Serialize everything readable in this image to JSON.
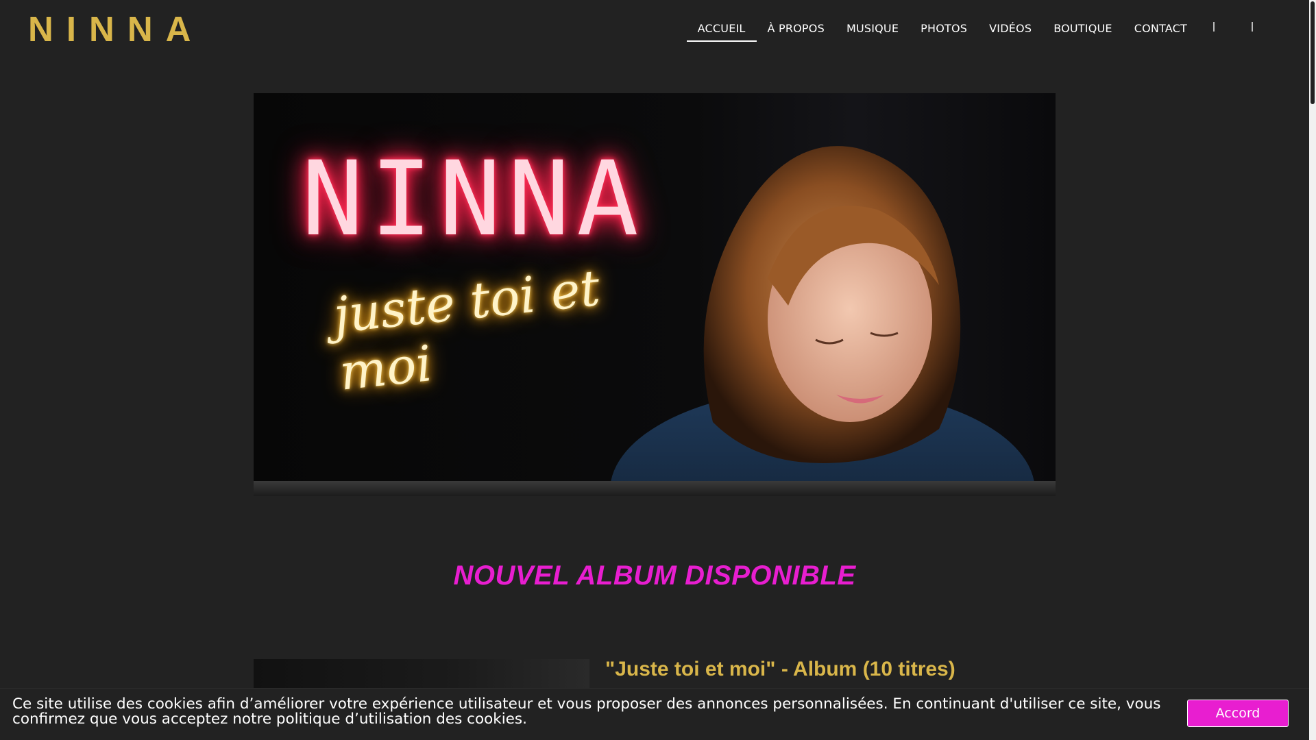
{
  "header": {
    "logo": "NINNA",
    "nav": [
      {
        "label": "ACCUEIL",
        "active": true
      },
      {
        "label": "À PROPOS"
      },
      {
        "label": "MUSIQUE"
      },
      {
        "label": "PHOTOS"
      },
      {
        "label": "VIDÉOS"
      },
      {
        "label": "BOUTIQUE"
      },
      {
        "label": "CONTACT"
      }
    ],
    "icons": [
      "search-icon",
      "cart-icon"
    ]
  },
  "hero": {
    "neon_title": "NINNA",
    "neon_subtitle": "juste toi et moi"
  },
  "main": {
    "section_title": "NOUVEL ALBUM DISPONIBLE",
    "album_title": "\"Juste toi et moi\" - Album (10 titres)"
  },
  "cookie_bar": {
    "text": "Ce site utilise des cookies afin d’améliorer votre expérience utilisateur et vous proposer des annonces personnalisées. En continuant d'utiliser ce site, vous confirmez que vous acceptez notre politique d’utilisation des cookies.",
    "button_label": "Accord"
  },
  "colors": {
    "background": "#222222",
    "logo_gold": "#d9b64a",
    "accent_magenta": "#e81ed0"
  }
}
